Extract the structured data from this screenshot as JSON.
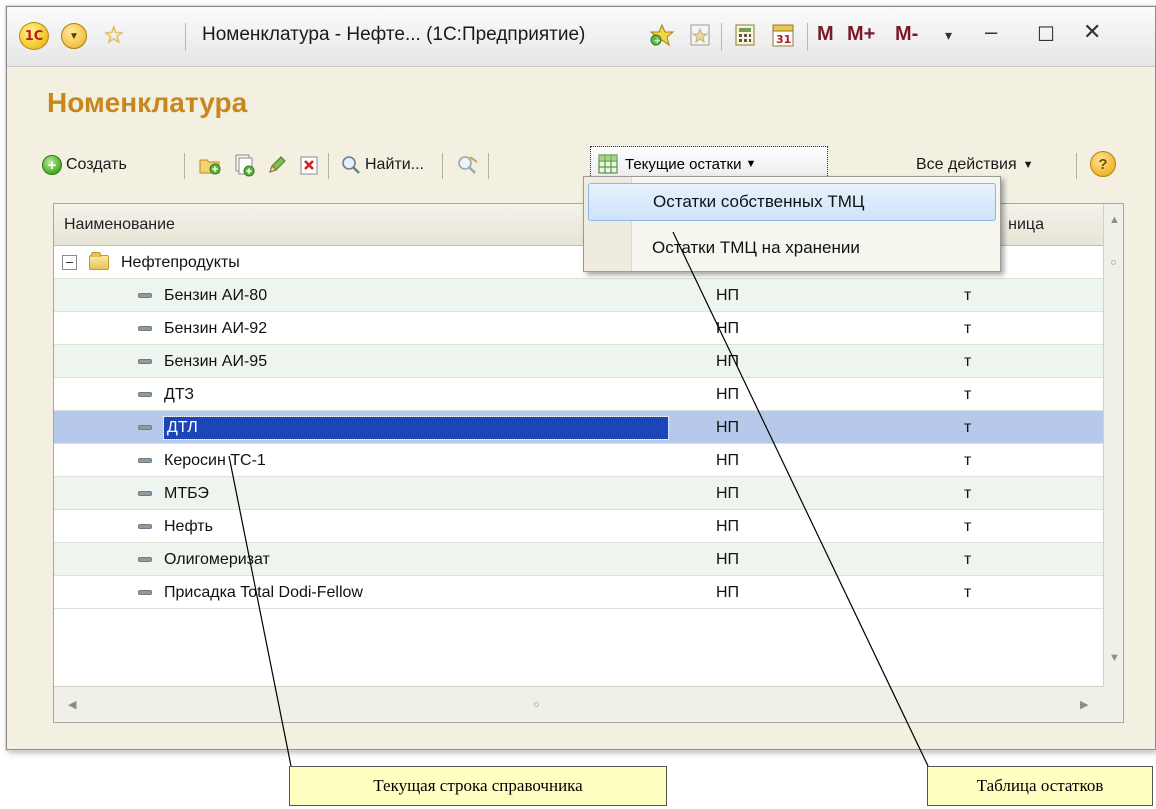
{
  "window": {
    "title": "Номенклатура - Нефте... (1С:Предприятие)",
    "logo": "1С",
    "titlebar_icons": [
      "back-circle-icon",
      "favorite-star-icon",
      "add-favorite-icon",
      "history-icon",
      "calculator-icon",
      "calendar-icon"
    ],
    "calendar_day": "31",
    "mem_buttons": [
      "M",
      "M+",
      "M-"
    ]
  },
  "form": {
    "title": "Номенклатура"
  },
  "toolbar": {
    "create_label": "Создать",
    "find_label": "Найти...",
    "current_balances_label": "Текущие остатки",
    "all_actions_label": "Все действия",
    "help_label": "?"
  },
  "dropdown": {
    "items": [
      {
        "label": "Остатки собственных ТМЦ",
        "highlighted": true
      },
      {
        "label": "Остатки ТМЦ на хранении",
        "highlighted": false
      }
    ]
  },
  "table": {
    "columns": [
      "Наименование",
      "",
      "ница"
    ],
    "group_row": {
      "name": "Нефтепродукты"
    },
    "rows": [
      {
        "name": "Бензин АИ-80",
        "group": "НП",
        "unit": "т"
      },
      {
        "name": "Бензин АИ-92",
        "group": "НП",
        "unit": "т"
      },
      {
        "name": "Бензин АИ-95",
        "group": "НП",
        "unit": "т"
      },
      {
        "name": "ДТЗ",
        "group": "НП",
        "unit": "т"
      },
      {
        "name": "ДТЛ",
        "group": "НП",
        "unit": "т"
      },
      {
        "name": "Керосин ТС-1",
        "group": "НП",
        "unit": "т"
      },
      {
        "name": "МТБЭ",
        "group": "НП",
        "unit": "т"
      },
      {
        "name": "Нефть",
        "group": "НП",
        "unit": "т"
      },
      {
        "name": "Олигомеризат",
        "group": "НП",
        "unit": "т"
      },
      {
        "name": "Присадка Total Dodi-Fellow",
        "group": "НП",
        "unit": "т"
      }
    ],
    "selected_row": 4
  },
  "callouts": {
    "current_row": "Текущая строка справочника",
    "balances_table": "Таблица остатков"
  },
  "colors": {
    "form_title": "#c8871a",
    "selection_row": "#b7c9ea",
    "selection_text": "#1c45b8",
    "alt_row": "#eef5ee",
    "callout_bg": "#ffffc2"
  }
}
